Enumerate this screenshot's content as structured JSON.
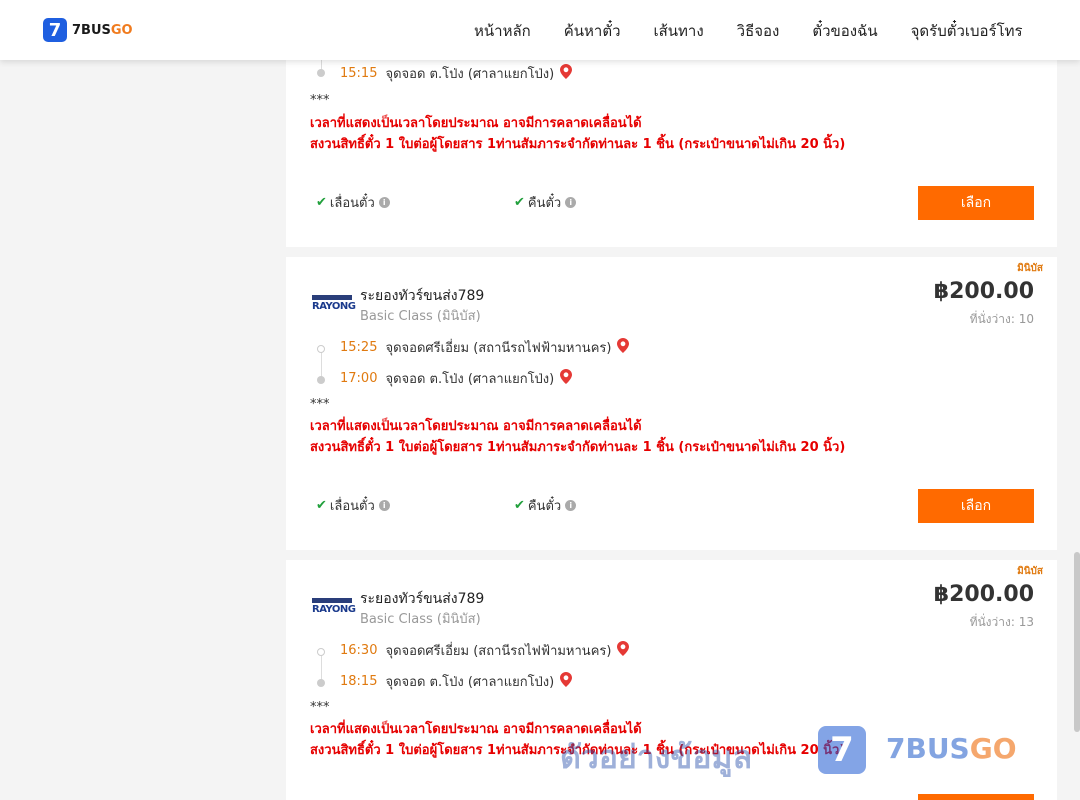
{
  "header": {
    "logo_mark": "7",
    "logo_brand": "7BUS",
    "logo_brand_go": "GO",
    "nav": [
      "หน้าหลัก",
      "ค้นหาตั๋ว",
      "เส้นทาง",
      "วิธีจอง",
      "ตั๋วของฉัน",
      "จุดรับตั๋วเบอร์โทร"
    ]
  },
  "card0": {
    "stop_arrive": {
      "time": "15:15",
      "place": "จุดจอด ต.โป่ง (ศาลาแยกโป่ง)"
    },
    "note": "***",
    "warn1": "เวลาที่แสดงเป็นเวลาโดยประมาณ อาจมีการคลาดเคลื่อนได้",
    "warn2": "สงวนสิทธิ์ตั๋ว 1 ใบต่อผู้โดยสาร 1ท่านสัมภาระจำกัดท่านละ 1 ชิ้น (กระเป๋าขนาดไม่เกิน 20 นิ้ว)",
    "policy1": "เลื่อนตั๋ว",
    "policy2": "คืนตั๋ว",
    "select": "เลือก"
  },
  "card1": {
    "badge": "มินิบัส",
    "operator": "ระยองทัวร์ขนส่ง789",
    "class": "Basic Class (มินิบัส)",
    "logo_text": "RAYONG",
    "price": "฿200.00",
    "seats": "ที่นั่งว่าง: 10",
    "stop_depart": {
      "time": "15:25",
      "place": "จุดจอดศรีเอี่ยม (สถานีรถไฟฟ้ามหานคร)"
    },
    "stop_arrive": {
      "time": "17:00",
      "place": "จุดจอด ต.โป่ง (ศาลาแยกโป่ง)"
    },
    "note": "***",
    "warn1": "เวลาที่แสดงเป็นเวลาโดยประมาณ อาจมีการคลาดเคลื่อนได้",
    "warn2": "สงวนสิทธิ์ตั๋ว 1 ใบต่อผู้โดยสาร 1ท่านสัมภาระจำกัดท่านละ 1 ชิ้น (กระเป๋าขนาดไม่เกิน 20 นิ้ว)",
    "policy1": "เลื่อนตั๋ว",
    "policy2": "คืนตั๋ว",
    "select": "เลือก"
  },
  "card2": {
    "badge": "มินิบัส",
    "operator": "ระยองทัวร์ขนส่ง789",
    "class": "Basic Class (มินิบัส)",
    "logo_text": "RAYONG",
    "price": "฿200.00",
    "seats": "ที่นั่งว่าง: 13",
    "stop_depart": {
      "time": "16:30",
      "place": "จุดจอดศรีเอี่ยม (สถานีรถไฟฟ้ามหานคร)"
    },
    "stop_arrive": {
      "time": "18:15",
      "place": "จุดจอด ต.โป่ง (ศาลาแยกโป่ง)"
    },
    "note": "***",
    "warn1": "เวลาที่แสดงเป็นเวลาโดยประมาณ อาจมีการคลาดเคลื่อนได้",
    "warn2": "สงวนสิทธิ์ตั๋ว 1 ใบต่อผู้โดยสาร 1ท่านสัมภาระจำกัดท่านละ 1 ชิ้น (กระเป๋าขนาดไม่เกิน 20 นิ้ว)"
  },
  "watermark": {
    "text": "ตัวอย่างข้อมูล",
    "mark": "7",
    "brand": "7BUS",
    "brand_go": "GO"
  },
  "colors": {
    "accent": "#ff6a00",
    "time": "#e07a10",
    "warning": "#e60000",
    "check": "#21a03c",
    "logo": "#1f5fe0"
  }
}
